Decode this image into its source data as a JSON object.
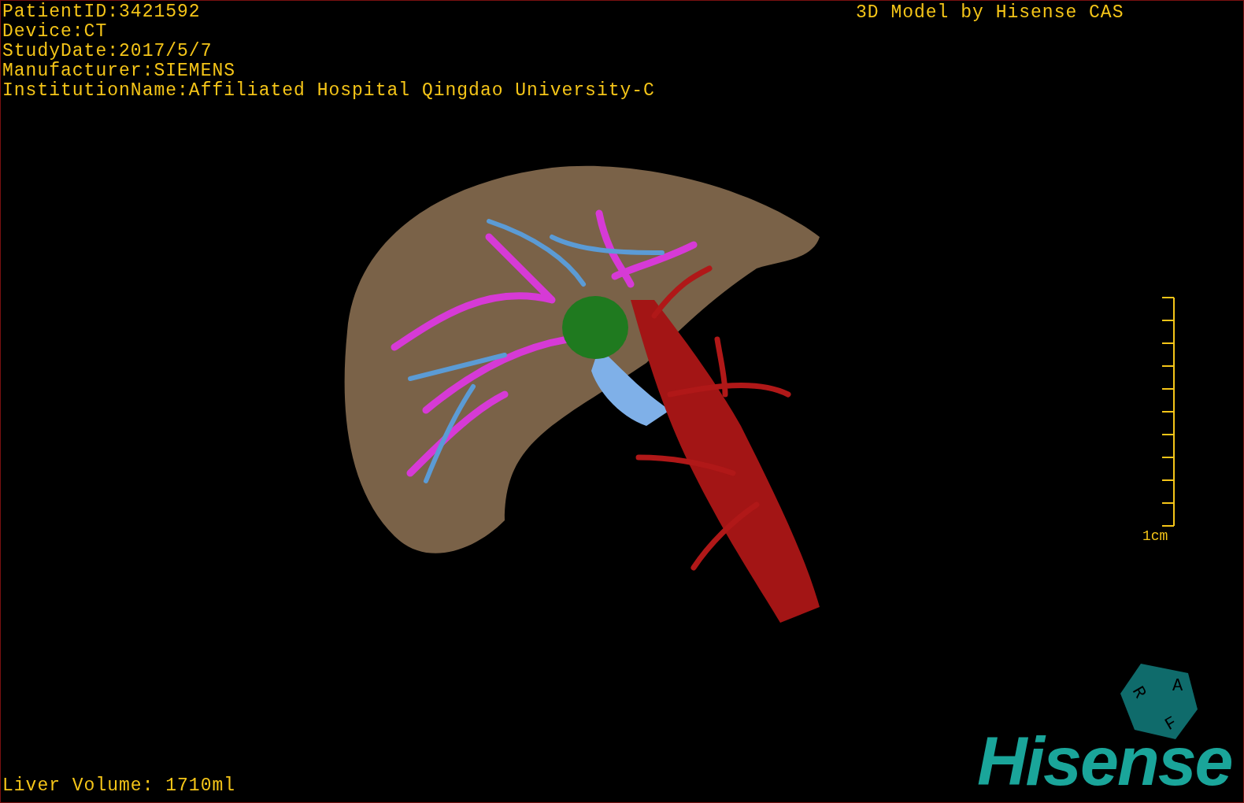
{
  "patient_info": [
    "PatientID:3421592",
    "Device:CT",
    "StudyDate:2017/5/7",
    "Manufacturer:SIEMENS",
    "InstitutionName:Affiliated Hospital Qingdao University-C"
  ],
  "header_right": "3D Model by Hisense CAS",
  "scale_bar": {
    "label": "1cm"
  },
  "orientation_cube": {
    "labels": [
      "R",
      "A",
      "F"
    ]
  },
  "liver_volume": "Liver Volume: 1710ml",
  "logo": "Hisense"
}
